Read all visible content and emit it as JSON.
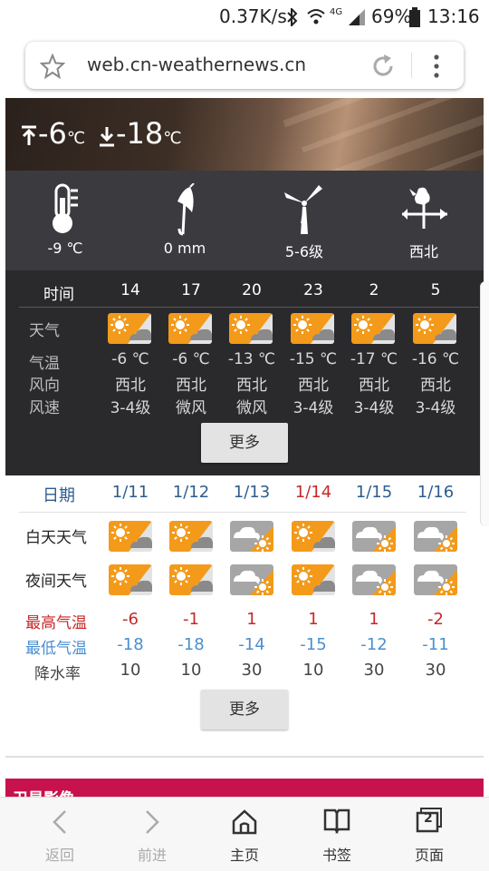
{
  "status_bar": {
    "speed": "0.37K/s",
    "network": "4G",
    "battery": "69%",
    "time": "13:16"
  },
  "browser": {
    "url": "web.cn-weathernews.cn"
  },
  "hero": {
    "high": "-6",
    "low": "-18",
    "unit": "℃"
  },
  "current": [
    {
      "icon": "thermometer-icon",
      "label": "-9 ℃"
    },
    {
      "icon": "umbrella-icon",
      "label": "0 mm"
    },
    {
      "icon": "wind-turbine-icon",
      "label": "5-6级"
    },
    {
      "icon": "weathervane-icon",
      "label": "西北"
    }
  ],
  "hourly": {
    "time_label": "时间",
    "hours": [
      "14",
      "17",
      "20",
      "23",
      "2",
      "5"
    ],
    "row_labels": {
      "weather": "天气",
      "temp": "气温",
      "wind_dir": "风向",
      "wind_speed": "风速"
    },
    "temps": [
      "-6 ℃",
      "-6 ℃",
      "-13 ℃",
      "-15 ℃",
      "-17 ℃",
      "-16 ℃"
    ],
    "wind_dirs": [
      "西北",
      "西北",
      "西北",
      "西北",
      "西北",
      "西北"
    ],
    "wind_speeds": [
      "3-4级",
      "微风",
      "微风",
      "3-4级",
      "3-4级",
      "3-4级"
    ],
    "icons": [
      "sunny-cloudy",
      "sunny-cloudy",
      "sunny-cloudy",
      "sunny-cloudy",
      "sunny-cloudy",
      "sunny-cloudy"
    ],
    "more": "更多"
  },
  "daily": {
    "date_label": "日期",
    "dates": [
      "1/11",
      "1/12",
      "1/13",
      "1/14",
      "1/15",
      "1/16"
    ],
    "day_label": "白天天气",
    "night_label": "夜间天气",
    "day_icons": [
      "sunny-cloudy",
      "sunny-cloudy",
      "cloudy-sunny",
      "sunny-cloudy",
      "cloudy-sunny",
      "cloudy-sunny"
    ],
    "night_icons": [
      "sunny-cloudy",
      "sunny-cloudy",
      "cloudy-sunny",
      "sunny-cloudy",
      "cloudy-sunny",
      "cloudy-sunny"
    ],
    "high_label": "最高气温",
    "low_label": "最低气温",
    "rain_label": "降水率",
    "highs": [
      "-6",
      "-1",
      "1",
      "1",
      "1",
      "-2"
    ],
    "lows": [
      "-18",
      "-18",
      "-14",
      "-15",
      "-12",
      "-11"
    ],
    "rain": [
      "10",
      "10",
      "30",
      "10",
      "30",
      "30"
    ],
    "more": "更多",
    "colors": {
      "date": "#2d5d8f",
      "highlight_date": "#c62828",
      "high": "#c62828",
      "low": "#4a8fd0"
    }
  },
  "satellite": {
    "label": "卫星影像"
  },
  "bottom_nav": [
    {
      "label": "返回",
      "icon": "back-icon"
    },
    {
      "label": "前进",
      "icon": "forward-icon"
    },
    {
      "label": "主页",
      "icon": "home-icon"
    },
    {
      "label": "书签",
      "icon": "bookmark-icon"
    },
    {
      "label": "页面",
      "icon": "tabs-icon",
      "count": "2"
    }
  ]
}
